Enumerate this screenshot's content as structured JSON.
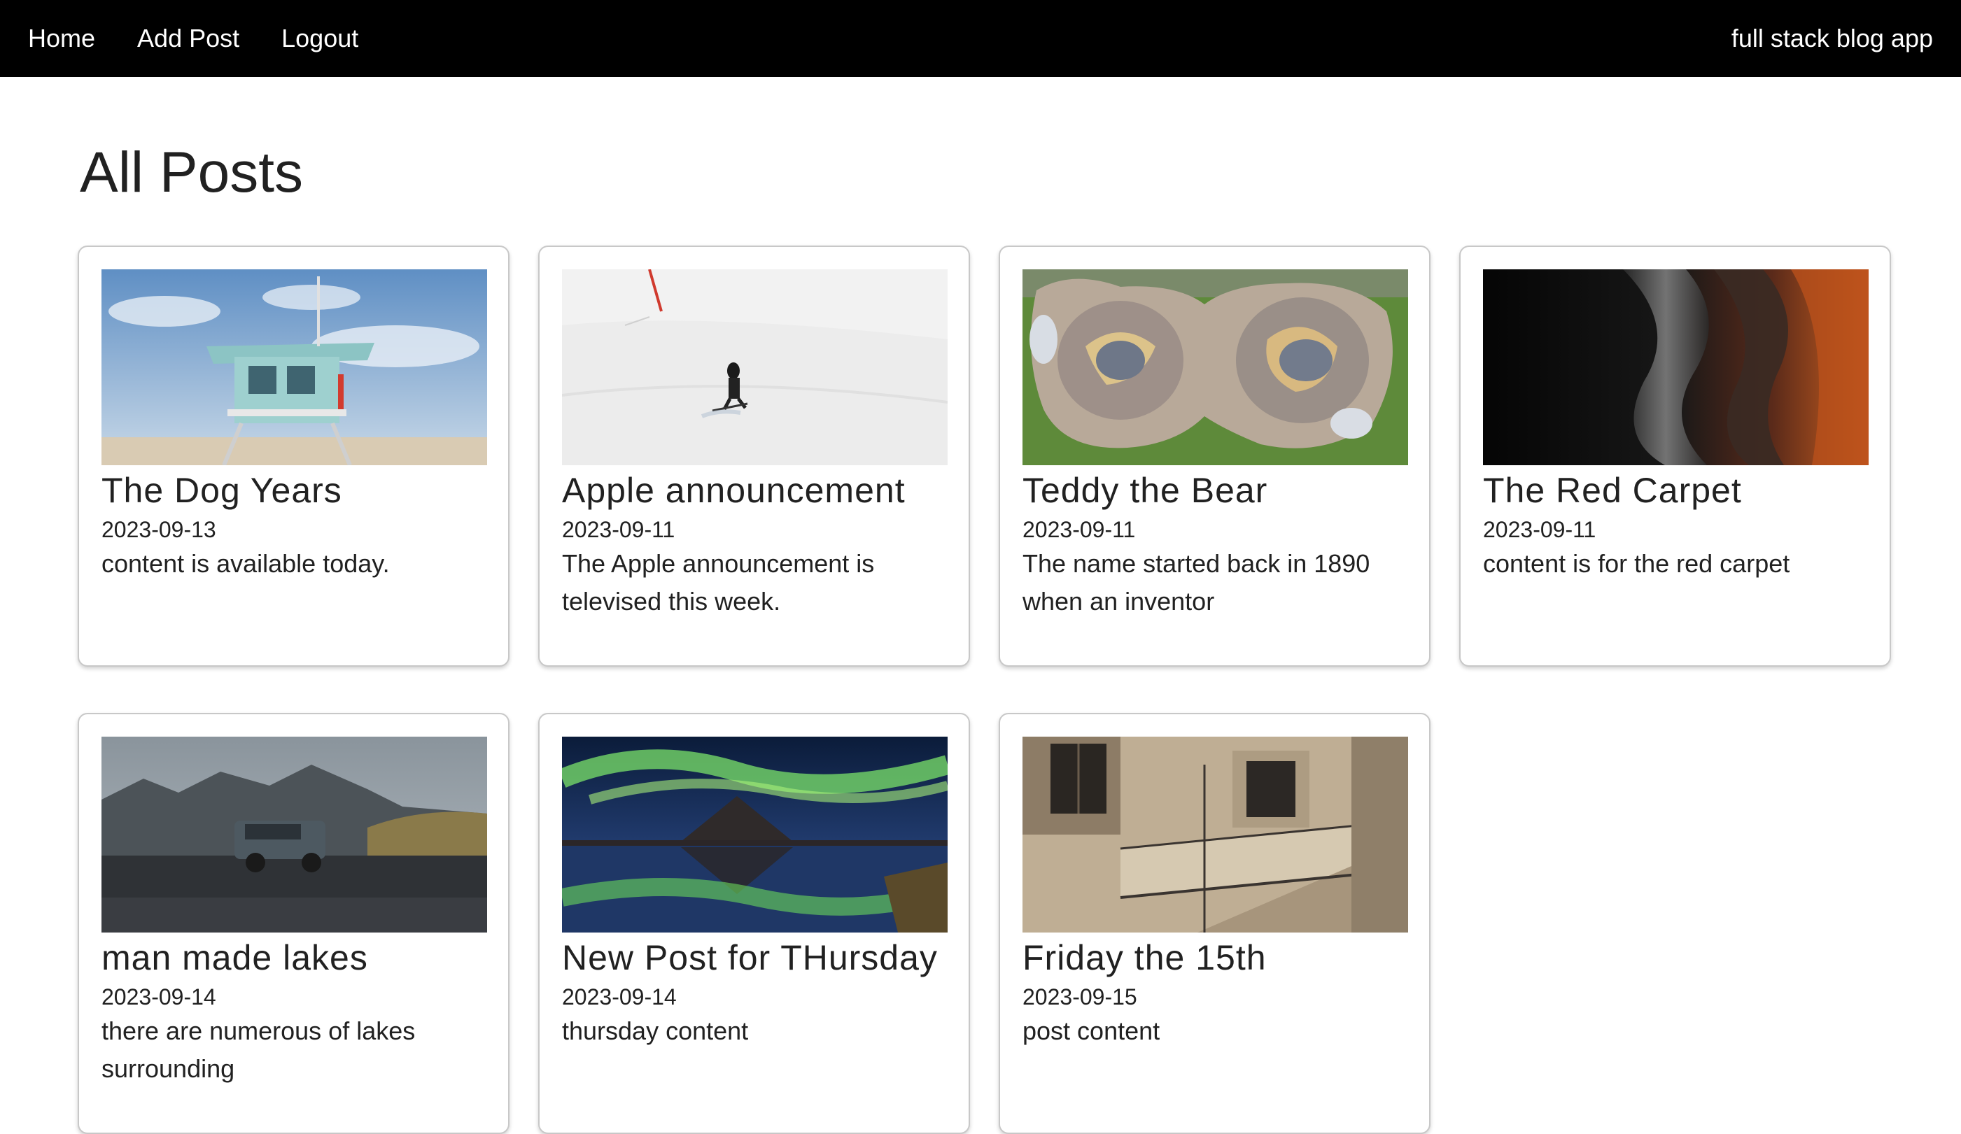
{
  "nav": {
    "home": "Home",
    "add_post": "Add Post",
    "logout": "Logout",
    "brand": "full stack blog app"
  },
  "page": {
    "title": "All Posts"
  },
  "posts": [
    {
      "title": "The Dog Years",
      "date": "2023-09-13",
      "content": "content is available today.",
      "image": "lifeguard-tower-photo"
    },
    {
      "title": "Apple announcement",
      "date": "2023-09-11",
      "content": "The Apple announcement is televised this week.",
      "image": "skier-snow-photo"
    },
    {
      "title": "Teddy the Bear",
      "date": "2023-09-11",
      "content": "The name started back in 1890 when an inventor",
      "image": "skatepark-aerial-photo"
    },
    {
      "title": "The Red Carpet",
      "date": "2023-09-11",
      "content": "content is for the red carpet",
      "image": "abstract-waves-photo"
    },
    {
      "title": "man made lakes",
      "date": "2023-09-14",
      "content": "there are numerous of lakes surrounding",
      "image": "suv-mountains-photo"
    },
    {
      "title": "New Post for THursday",
      "date": "2023-09-14",
      "content": "thursday content",
      "image": "aurora-mountain-photo"
    },
    {
      "title": "Friday the 15th",
      "date": "2023-09-15",
      "content": "post content",
      "image": "building-stairs-photo"
    }
  ],
  "colors": {
    "navbar": "#000000",
    "text": "#212121",
    "card_border": "#c8c8c8"
  }
}
